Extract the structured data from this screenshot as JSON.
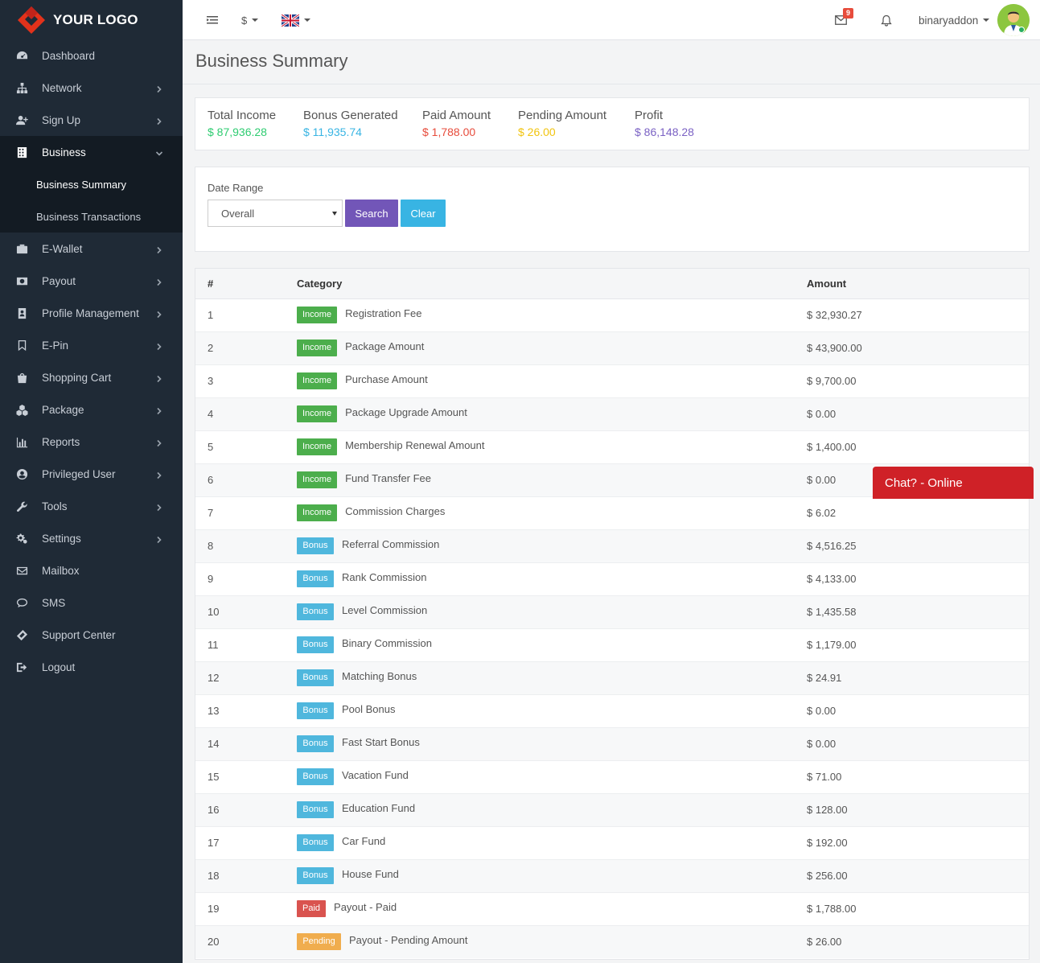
{
  "logo": {
    "text": "YOUR LOGO"
  },
  "sidebar": {
    "items": [
      {
        "label": "Dashboard",
        "icon": "dashboard-icon",
        "has_children": false
      },
      {
        "label": "Network",
        "icon": "network-icon",
        "has_children": true
      },
      {
        "label": "Sign Up",
        "icon": "user-plus-icon",
        "has_children": true
      },
      {
        "label": "Business",
        "icon": "building-icon",
        "has_children": true,
        "expanded": true
      },
      {
        "label": "E-Wallet",
        "icon": "wallet-icon",
        "has_children": true
      },
      {
        "label": "Payout",
        "icon": "money-icon",
        "has_children": true
      },
      {
        "label": "Profile Management",
        "icon": "profile-icon",
        "has_children": true
      },
      {
        "label": "E-Pin",
        "icon": "bookmark-icon",
        "has_children": true
      },
      {
        "label": "Shopping Cart",
        "icon": "shopping-bag-icon",
        "has_children": true
      },
      {
        "label": "Package",
        "icon": "cubes-icon",
        "has_children": true
      },
      {
        "label": "Reports",
        "icon": "bar-chart-icon",
        "has_children": true
      },
      {
        "label": "Privileged User",
        "icon": "user-circle-icon",
        "has_children": true
      },
      {
        "label": "Tools",
        "icon": "wrench-icon",
        "has_children": true
      },
      {
        "label": "Settings",
        "icon": "gears-icon",
        "has_children": true
      },
      {
        "label": "Mailbox",
        "icon": "envelope-icon",
        "has_children": false
      },
      {
        "label": "SMS",
        "icon": "chat-icon",
        "has_children": false
      },
      {
        "label": "Support Center",
        "icon": "ticket-icon",
        "has_children": false
      },
      {
        "label": "Logout",
        "icon": "logout-icon",
        "has_children": false
      }
    ],
    "business_sub": [
      "Business Summary",
      "Business Transactions"
    ]
  },
  "topbar": {
    "currency": "$",
    "mail_count": "9",
    "username": "binaryaddon"
  },
  "page": {
    "title": "Business Summary"
  },
  "summary": [
    {
      "title": "Total Income",
      "value": "$ 87,936.28",
      "color": "#2ecc71"
    },
    {
      "title": "Bonus Generated",
      "value": "$ 11,935.74",
      "color": "#38b4e3"
    },
    {
      "title": "Paid Amount",
      "value": "$ 1,788.00",
      "color": "#e74c3c"
    },
    {
      "title": "Pending Amount",
      "value": "$ 26.00",
      "color": "#f1c40f"
    },
    {
      "title": "Profit",
      "value": "$ 86,148.28",
      "color": "#7b62c4"
    }
  ],
  "filter": {
    "label": "Date Range",
    "selected": "Overall",
    "search_label": "Search",
    "clear_label": "Clear"
  },
  "table": {
    "headers": [
      "#",
      "Category",
      "Amount"
    ],
    "rows": [
      {
        "n": "1",
        "tag": "Income",
        "type": "income",
        "category": "Registration Fee",
        "amount": "$ 32,930.27"
      },
      {
        "n": "2",
        "tag": "Income",
        "type": "income",
        "category": "Package Amount",
        "amount": "$ 43,900.00"
      },
      {
        "n": "3",
        "tag": "Income",
        "type": "income",
        "category": "Purchase Amount",
        "amount": "$ 9,700.00"
      },
      {
        "n": "4",
        "tag": "Income",
        "type": "income",
        "category": "Package Upgrade Amount",
        "amount": "$ 0.00"
      },
      {
        "n": "5",
        "tag": "Income",
        "type": "income",
        "category": "Membership Renewal Amount",
        "amount": "$ 1,400.00"
      },
      {
        "n": "6",
        "tag": "Income",
        "type": "income",
        "category": "Fund Transfer Fee",
        "amount": "$ 0.00"
      },
      {
        "n": "7",
        "tag": "Income",
        "type": "income",
        "category": "Commission Charges",
        "amount": "$ 6.02"
      },
      {
        "n": "8",
        "tag": "Bonus",
        "type": "bonus",
        "category": "Referral Commission",
        "amount": "$ 4,516.25"
      },
      {
        "n": "9",
        "tag": "Bonus",
        "type": "bonus",
        "category": "Rank Commission",
        "amount": "$ 4,133.00"
      },
      {
        "n": "10",
        "tag": "Bonus",
        "type": "bonus",
        "category": "Level Commission",
        "amount": "$ 1,435.58"
      },
      {
        "n": "11",
        "tag": "Bonus",
        "type": "bonus",
        "category": "Binary Commission",
        "amount": "$ 1,179.00"
      },
      {
        "n": "12",
        "tag": "Bonus",
        "type": "bonus",
        "category": "Matching Bonus",
        "amount": "$ 24.91"
      },
      {
        "n": "13",
        "tag": "Bonus",
        "type": "bonus",
        "category": "Pool Bonus",
        "amount": "$ 0.00"
      },
      {
        "n": "14",
        "tag": "Bonus",
        "type": "bonus",
        "category": "Fast Start Bonus",
        "amount": "$ 0.00"
      },
      {
        "n": "15",
        "tag": "Bonus",
        "type": "bonus",
        "category": "Vacation Fund",
        "amount": "$ 71.00"
      },
      {
        "n": "16",
        "tag": "Bonus",
        "type": "bonus",
        "category": "Education Fund",
        "amount": "$ 128.00"
      },
      {
        "n": "17",
        "tag": "Bonus",
        "type": "bonus",
        "category": "Car Fund",
        "amount": "$ 192.00"
      },
      {
        "n": "18",
        "tag": "Bonus",
        "type": "bonus",
        "category": "House Fund",
        "amount": "$ 256.00"
      },
      {
        "n": "19",
        "tag": "Paid",
        "type": "paid",
        "category": "Payout - Paid",
        "amount": "$ 1,788.00"
      },
      {
        "n": "20",
        "tag": "Pending",
        "type": "pending",
        "category": "Payout - Pending Amount",
        "amount": "$ 26.00"
      }
    ]
  },
  "chat": {
    "label": "Chat? - Online"
  }
}
